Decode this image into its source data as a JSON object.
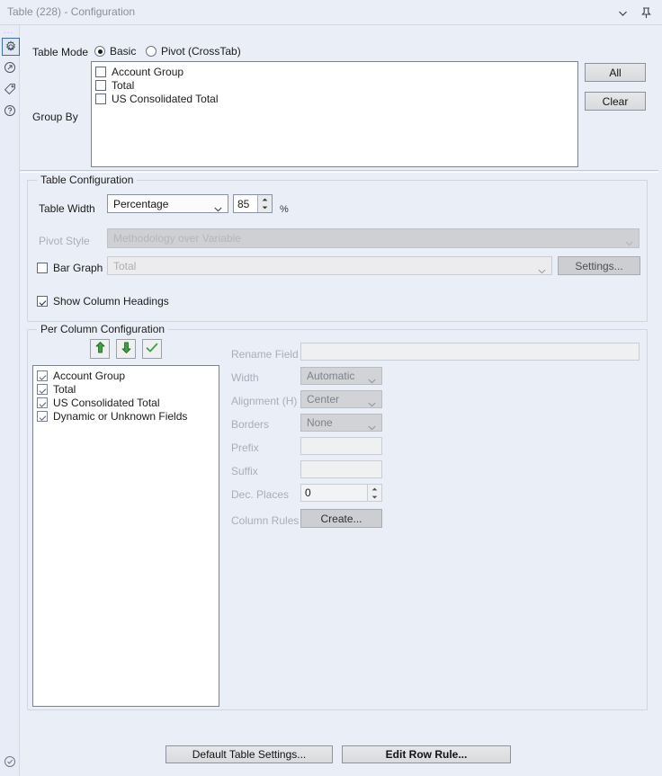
{
  "window": {
    "title": "Table (228) - Configuration",
    "chevron_icon": "chevron-down-icon",
    "pin_icon": "pin-icon"
  },
  "rail": {
    "dots": "...",
    "items": [
      {
        "icon": "gear-icon",
        "selected": true
      },
      {
        "icon": "export-arrow-icon",
        "selected": false
      },
      {
        "icon": "tag-icon",
        "selected": false
      },
      {
        "icon": "help-icon",
        "selected": false
      }
    ],
    "bottom": {
      "icon": "check-circle-icon"
    }
  },
  "table_mode": {
    "label": "Table Mode",
    "options": [
      {
        "label": "Basic",
        "selected": true
      },
      {
        "label": "Pivot (CrossTab)",
        "selected": false
      }
    ]
  },
  "group_by": {
    "label": "Group By",
    "items": [
      {
        "label": "Account Group",
        "checked": false
      },
      {
        "label": "Total",
        "checked": false
      },
      {
        "label": "US Consolidated Total",
        "checked": false
      }
    ],
    "buttons": [
      {
        "label": "All",
        "name": "all-button"
      },
      {
        "label": "Clear",
        "name": "clear-button"
      }
    ]
  },
  "table_configuration": {
    "title": "Table Configuration",
    "table_width": {
      "label": "Table Width",
      "value": "Percentage",
      "number": "85",
      "unit": "%"
    },
    "pivot_style": {
      "label": "Pivot Style",
      "value": "Methodology over Variable",
      "disabled": true
    },
    "bar_graph": {
      "label": "Bar Graph",
      "checked": false,
      "value": "Total",
      "settings_label": "Settings..."
    },
    "show_column_headings": {
      "label": "Show Column Headings",
      "checked": true
    }
  },
  "per_column_configuration": {
    "title": "Per Column Configuration",
    "toolbar": [
      {
        "icon": "move-up-icon",
        "name": "move-up-button"
      },
      {
        "icon": "move-down-icon",
        "name": "move-down-button"
      },
      {
        "icon": "check-icon",
        "name": "toggle-check-button"
      }
    ],
    "columns": [
      {
        "label": "Account Group",
        "checked": true
      },
      {
        "label": "Total",
        "checked": true
      },
      {
        "label": "US Consolidated Total",
        "checked": true
      },
      {
        "label": "Dynamic or Unknown Fields",
        "checked": true
      }
    ],
    "fields": {
      "rename_field": {
        "label": "Rename Field",
        "value": ""
      },
      "width": {
        "label": "Width",
        "value": "Automatic"
      },
      "alignment": {
        "label": "Alignment (H)",
        "value": "Center"
      },
      "borders": {
        "label": "Borders",
        "value": "None"
      },
      "prefix": {
        "label": "Prefix",
        "value": ""
      },
      "suffix": {
        "label": "Suffix",
        "value": ""
      },
      "dec_places": {
        "label": "Dec. Places",
        "value": "0"
      },
      "column_rules": {
        "label": "Column Rules",
        "button_label": "Create..."
      }
    }
  },
  "footer": {
    "default_table_settings": "Default Table Settings...",
    "edit_row_rule": "Edit Row Rule..."
  }
}
